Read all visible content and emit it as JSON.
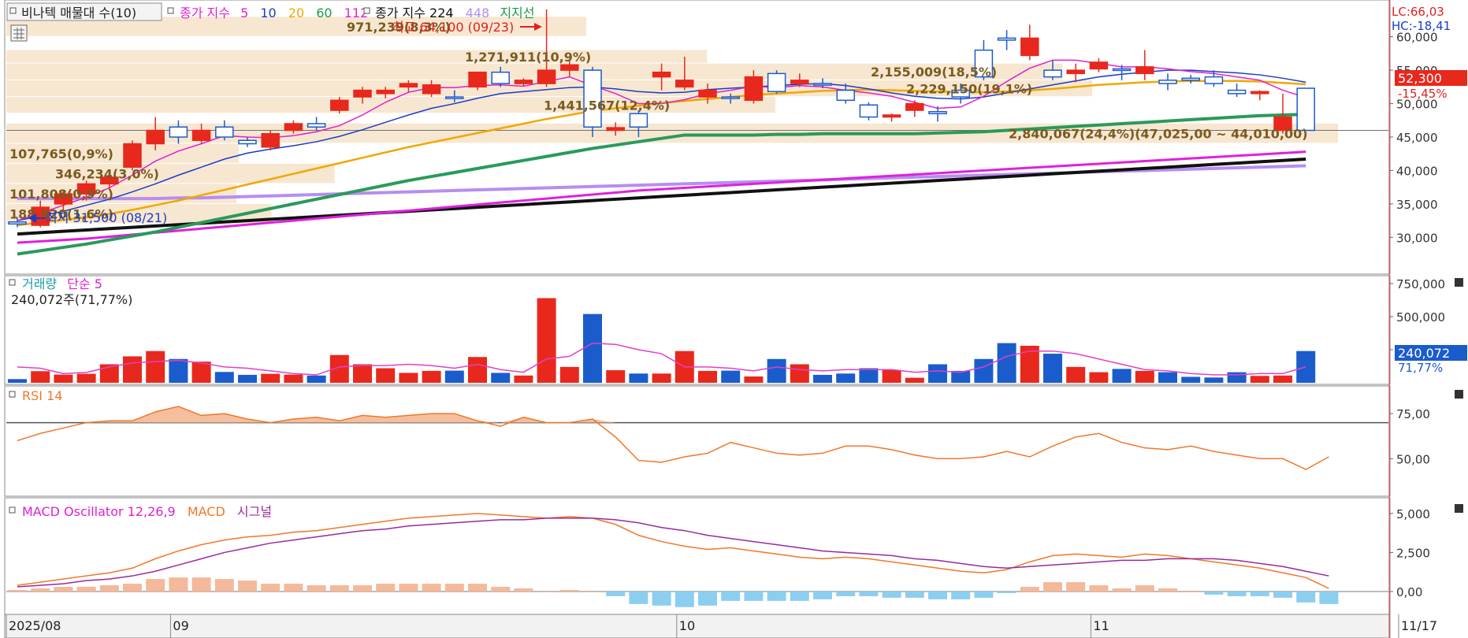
{
  "header": {
    "indicator": "비나텍 매물대 수(10)",
    "ma_title": "종가 지수",
    "ma_periods": [
      {
        "label": "5",
        "color": "#e020d0"
      },
      {
        "label": "10",
        "color": "#1a3cc8"
      },
      {
        "label": "20",
        "color": "#f0a800"
      },
      {
        "label": "60",
        "color": "#1a9a4a"
      },
      {
        "label": "112",
        "color": "#e020e0"
      }
    ],
    "ma2_title": "종가 지수 224",
    "ma2_extra": {
      "label": "448",
      "color": "#b68ef0"
    },
    "support_label": "지지선",
    "corner_lc": "LC:66,03",
    "corner_hc": "HC:-18,41"
  },
  "annotations": {
    "high_label": "최고 64,100 (09/23)",
    "low_label": "최저 31,500 (08/21)"
  },
  "price_badge": {
    "price": "52,300",
    "change": "-15,45%"
  },
  "volume_panel": {
    "title": "거래량",
    "ma_label": "단순 5",
    "last_info": "240,072주(71,77%)",
    "badge_value": "240,072",
    "badge_pct": "71,77%"
  },
  "rsi_panel": {
    "title": "RSI 14"
  },
  "macd_panel": {
    "title": "MACD Oscillator 12,26,9",
    "macd_label": "MACD",
    "signal_label": "시그널"
  },
  "colors": {
    "up": "#e8281c",
    "down": "#1a5ccc",
    "volume_ma": "#e040c8",
    "rsi": "#f07828",
    "rsi_fill": "#f4b894",
    "macd": "#f07828",
    "signal": "#9a2a9a",
    "osc_pos": "#f4b89a",
    "osc_neg": "#8ccef0",
    "profile": "#f6e4cc"
  },
  "chart_data": {
    "type": "candlestick",
    "price_axis": {
      "ticks": [
        "60,000",
        "55,000",
        "50,000",
        "45,000",
        "40,000",
        "35,000",
        "30,000"
      ],
      "values": [
        60000,
        55000,
        50000,
        45000,
        40000,
        35000,
        30000
      ]
    },
    "volume_axis": {
      "ticks": [
        "750,000",
        "500,000",
        "250,000"
      ],
      "values": [
        750000,
        500000,
        250000
      ]
    },
    "rsi_axis": {
      "ticks": [
        "75,00",
        "50,00"
      ],
      "values": [
        75,
        50
      ]
    },
    "macd_axis": {
      "ticks": [
        "5,000",
        "2,500",
        "0,00"
      ],
      "values": [
        5000,
        2500,
        0
      ]
    },
    "date_labels": [
      {
        "label": "2025/08",
        "index": 0
      },
      {
        "label": "09",
        "index": 7
      },
      {
        "label": "10",
        "index": 29
      },
      {
        "label": "11",
        "index": 47
      },
      {
        "label": "11/17",
        "index": 60
      }
    ],
    "candles": [
      {
        "o": 32300,
        "h": 33000,
        "l": 31500,
        "c": 32000
      },
      {
        "o": 31800,
        "h": 35500,
        "l": 31500,
        "c": 34500
      },
      {
        "o": 35000,
        "h": 37000,
        "l": 34000,
        "c": 36500
      },
      {
        "o": 36500,
        "h": 38500,
        "l": 35500,
        "c": 38000
      },
      {
        "o": 38000,
        "h": 40000,
        "l": 37000,
        "c": 39000
      },
      {
        "o": 40500,
        "h": 44500,
        "l": 40000,
        "c": 44000
      },
      {
        "o": 44000,
        "h": 48000,
        "l": 43000,
        "c": 46000
      },
      {
        "o": 46500,
        "h": 47500,
        "l": 44000,
        "c": 45000
      },
      {
        "o": 44500,
        "h": 47000,
        "l": 44000,
        "c": 46000
      },
      {
        "o": 46500,
        "h": 47500,
        "l": 44500,
        "c": 45000
      },
      {
        "o": 44500,
        "h": 45000,
        "l": 43500,
        "c": 44000
      },
      {
        "o": 43500,
        "h": 46000,
        "l": 43000,
        "c": 45500
      },
      {
        "o": 46000,
        "h": 47500,
        "l": 45500,
        "c": 47000
      },
      {
        "o": 47000,
        "h": 48000,
        "l": 46000,
        "c": 46500
      },
      {
        "o": 49000,
        "h": 51000,
        "l": 48500,
        "c": 50500
      },
      {
        "o": 51000,
        "h": 52500,
        "l": 50000,
        "c": 52000
      },
      {
        "o": 51500,
        "h": 52500,
        "l": 50800,
        "c": 52000
      },
      {
        "o": 52500,
        "h": 53500,
        "l": 51800,
        "c": 53000
      },
      {
        "o": 51500,
        "h": 53500,
        "l": 51000,
        "c": 52800
      },
      {
        "o": 51000,
        "h": 52000,
        "l": 50200,
        "c": 50800
      },
      {
        "o": 52500,
        "h": 54700,
        "l": 52000,
        "c": 54700
      },
      {
        "o": 54700,
        "h": 55500,
        "l": 52500,
        "c": 53000
      },
      {
        "o": 53000,
        "h": 53800,
        "l": 52600,
        "c": 53500
      },
      {
        "o": 53000,
        "h": 64100,
        "l": 52500,
        "c": 55000
      },
      {
        "o": 55000,
        "h": 56500,
        "l": 54000,
        "c": 55800
      },
      {
        "o": 55000,
        "h": 55500,
        "l": 45000,
        "c": 46500
      },
      {
        "o": 46000,
        "h": 47200,
        "l": 45200,
        "c": 46400
      },
      {
        "o": 48500,
        "h": 49000,
        "l": 45000,
        "c": 46500
      },
      {
        "o": 54000,
        "h": 56000,
        "l": 52000,
        "c": 54700
      },
      {
        "o": 52500,
        "h": 57000,
        "l": 52000,
        "c": 53500
      },
      {
        "o": 51000,
        "h": 53000,
        "l": 50000,
        "c": 52000
      },
      {
        "o": 51000,
        "h": 51500,
        "l": 50000,
        "c": 50800
      },
      {
        "o": 50500,
        "h": 55000,
        "l": 50000,
        "c": 54000
      },
      {
        "o": 54500,
        "h": 55000,
        "l": 51500,
        "c": 51800
      },
      {
        "o": 53000,
        "h": 54500,
        "l": 52500,
        "c": 53500
      },
      {
        "o": 53000,
        "h": 53800,
        "l": 52300,
        "c": 52800
      },
      {
        "o": 52000,
        "h": 53000,
        "l": 50000,
        "c": 50500
      },
      {
        "o": 49800,
        "h": 50200,
        "l": 47500,
        "c": 48000
      },
      {
        "o": 48000,
        "h": 48500,
        "l": 47300,
        "c": 48300
      },
      {
        "o": 49000,
        "h": 50500,
        "l": 48000,
        "c": 50000
      },
      {
        "o": 48800,
        "h": 49600,
        "l": 47300,
        "c": 48500
      },
      {
        "o": 52000,
        "h": 53000,
        "l": 50000,
        "c": 51000
      },
      {
        "o": 58000,
        "h": 59500,
        "l": 53500,
        "c": 54000
      },
      {
        "o": 59800,
        "h": 61000,
        "l": 58000,
        "c": 59500
      },
      {
        "o": 57200,
        "h": 61800,
        "l": 56500,
        "c": 59800
      },
      {
        "o": 55000,
        "h": 56500,
        "l": 53500,
        "c": 54000
      },
      {
        "o": 54500,
        "h": 56000,
        "l": 53200,
        "c": 55000
      },
      {
        "o": 55200,
        "h": 56800,
        "l": 54700,
        "c": 56200
      },
      {
        "o": 55200,
        "h": 55800,
        "l": 53500,
        "c": 55000
      },
      {
        "o": 54500,
        "h": 58000,
        "l": 53500,
        "c": 55500
      },
      {
        "o": 53500,
        "h": 54500,
        "l": 52000,
        "c": 53000
      },
      {
        "o": 53800,
        "h": 54300,
        "l": 53000,
        "c": 53500
      },
      {
        "o": 54000,
        "h": 55000,
        "l": 52500,
        "c": 53000
      },
      {
        "o": 52000,
        "h": 53000,
        "l": 51000,
        "c": 51500
      },
      {
        "o": 51500,
        "h": 52000,
        "l": 50500,
        "c": 51800
      },
      {
        "o": 46000,
        "h": 51500,
        "l": 45500,
        "c": 48000
      },
      {
        "o": 52300,
        "h": 52300,
        "l": 46000,
        "c": 46000
      }
    ],
    "ma5": [
      32500,
      33600,
      34800,
      36000,
      37400,
      39300,
      41400,
      42900,
      44000,
      45200,
      45000,
      44900,
      45200,
      45800,
      46700,
      48300,
      50200,
      51700,
      52400,
      52400,
      52700,
      52800,
      52600,
      53300,
      54000,
      52700,
      51500,
      50000,
      50000,
      50600,
      51500,
      52000,
      52600,
      52400,
      52700,
      52500,
      52000,
      51600,
      51100,
      50200,
      49300,
      49500,
      51100,
      53300,
      55300,
      56500,
      56500,
      56000,
      55500,
      55500,
      55200,
      54800,
      54500,
      54000,
      53500,
      52000,
      50900
    ],
    "ma10": [
      32500,
      33200,
      33900,
      34800,
      35700,
      36800,
      38000,
      39300,
      40500,
      41700,
      42600,
      43200,
      43700,
      44300,
      45100,
      46100,
      47200,
      48300,
      49300,
      50000,
      50800,
      51500,
      51800,
      52100,
      52400,
      52500,
      52200,
      51800,
      51600,
      51700,
      52100,
      52300,
      52500,
      52700,
      52900,
      53000,
      52700,
      52200,
      51600,
      51100,
      50800,
      50700,
      51000,
      51600,
      52200,
      52800,
      53400,
      54000,
      54400,
      54700,
      55000,
      55000,
      54800,
      54600,
      54300,
      53800,
      53200
    ],
    "ma20": [
      31800,
      32200,
      32600,
      33000,
      33500,
      34100,
      34800,
      35500,
      36300,
      37100,
      37900,
      38700,
      39500,
      40300,
      41100,
      41900,
      42700,
      43500,
      44200,
      44900,
      45600,
      46300,
      47000,
      47700,
      48300,
      48900,
      49300,
      49700,
      50100,
      50400,
      50700,
      51000,
      51300,
      51500,
      51700,
      51900,
      52000,
      52100,
      52000,
      51900,
      51800,
      51700,
      51700,
      51800,
      52000,
      52200,
      52500,
      52800,
      53000,
      53200,
      53300,
      53400,
      53400,
      53400,
      53300,
      53100,
      52900
    ],
    "ma60": [
      27500,
      28000,
      28500,
      29000,
      29600,
      30200,
      30800,
      31500,
      32200,
      32900,
      33600,
      34300,
      35000,
      35700,
      36400,
      37100,
      37800,
      38500,
      39100,
      39700,
      40300,
      40900,
      41500,
      42100,
      42700,
      43300,
      43800,
      44300,
      44800,
      45300,
      45300,
      45300,
      45300,
      45400,
      45400,
      45500,
      45500,
      45500,
      45500,
      45500,
      45600,
      45700,
      45800,
      46000,
      46200,
      46400,
      46600,
      46800,
      47000,
      47200,
      47400,
      47600,
      47800,
      48000,
      48200,
      48300,
      48400
    ],
    "ma112": [
      29200,
      29400,
      29600,
      29800,
      30100,
      30400,
      30700,
      31000,
      31300,
      31600,
      31900,
      32200,
      32500,
      32800,
      33100,
      33400,
      33700,
      34000,
      34300,
      34600,
      34900,
      35200,
      35500,
      35800,
      36100,
      36400,
      36700,
      37000,
      37200,
      37400,
      37600,
      37800,
      38000,
      38200,
      38400,
      38600,
      38800,
      39000,
      39200,
      39400,
      39600,
      39800,
      40000,
      40200,
      40400,
      40600,
      40800,
      41000,
      41200,
      41400,
      41600,
      41800,
      42000,
      42200,
      42400,
      42600,
      42800
    ],
    "ma224": [
      30500,
      30700,
      30900,
      31100,
      31300,
      31500,
      31700,
      31900,
      32100,
      32300,
      32500,
      32700,
      32900,
      33100,
      33300,
      33500,
      33700,
      33900,
      34100,
      34300,
      34500,
      34700,
      34900,
      35100,
      35300,
      35500,
      35700,
      35900,
      36100,
      36300,
      36500,
      36700,
      36900,
      37100,
      37300,
      37500,
      37700,
      37900,
      38100,
      38300,
      38500,
      38700,
      38900,
      39100,
      39300,
      39500,
      39700,
      39900,
      40100,
      40300,
      40500,
      40700,
      40900,
      41100,
      41300,
      41500,
      41700
    ],
    "ma448": [
      35800,
      35800,
      35800,
      35800,
      35800,
      35800,
      35800,
      35900,
      35900,
      36000,
      36100,
      36200,
      36300,
      36400,
      36500,
      36600,
      36700,
      36800,
      36900,
      37000,
      37100,
      37200,
      37300,
      37400,
      37500,
      37600,
      37700,
      37800,
      37900,
      38000,
      38100,
      38200,
      38300,
      38400,
      38500,
      38600,
      38700,
      38800,
      38900,
      39000,
      39100,
      39200,
      39300,
      39400,
      39500,
      39600,
      39700,
      39800,
      39900,
      40000,
      40100,
      40200,
      40300,
      40400,
      40500,
      40600,
      40700
    ],
    "volume_profile": [
      {
        "label": "971,239(8,3%)",
        "price_low": 60000,
        "price_high": 63000,
        "value": 971239
      },
      {
        "label": "1,271,911(10,9%)",
        "price_low": 56000,
        "price_high": 58000,
        "value": 1271911
      },
      {
        "label": "2,155,009(18,5%)",
        "price_low": 53500,
        "price_high": 56000,
        "value": 2155009
      },
      {
        "label": "2,229,150(19,1%)",
        "price_low": 51000,
        "price_high": 53500,
        "value": 2229150
      },
      {
        "label": "1,441,567(12,4%)",
        "price_low": 48500,
        "price_high": 51000,
        "value": 1441567
      },
      {
        "label": "2,840,067(24,4%)(47,025,00 ~ 44,010,00)",
        "price_low": 44010,
        "price_high": 47025,
        "value": 2840067
      },
      {
        "label": "107,765(0,9%)",
        "price_low": 41000,
        "price_high": 44000,
        "value": 107765
      },
      {
        "label": "346,234(3,0%)",
        "price_low": 38000,
        "price_high": 41000,
        "value": 346234
      },
      {
        "label": "101,808(0,9%)",
        "price_low": 35000,
        "price_high": 38000,
        "value": 101808
      },
      {
        "label": "188,920(1,6%)",
        "price_low": 32000,
        "price_high": 35000,
        "value": 188920
      }
    ],
    "volume": [
      28000,
      88000,
      62000,
      68000,
      140000,
      200000,
      240000,
      180000,
      160000,
      82000,
      60000,
      68000,
      62000,
      55000,
      210000,
      140000,
      110000,
      75000,
      90000,
      92000,
      195000,
      75000,
      55000,
      640000,
      120000,
      520000,
      95000,
      70000,
      70000,
      240000,
      90000,
      92000,
      48000,
      180000,
      140000,
      60000,
      70000,
      110000,
      95000,
      38000,
      140000,
      90000,
      180000,
      300000,
      280000,
      220000,
      120000,
      80000,
      105000,
      90000,
      80000,
      45000,
      40000,
      80000,
      52000,
      55000,
      240072
    ],
    "volume_ma5": [
      120000,
      110000,
      70000,
      78000,
      120000,
      150000,
      160000,
      170000,
      150000,
      120000,
      110000,
      90000,
      70000,
      60000,
      120000,
      130000,
      130000,
      140000,
      130000,
      110000,
      140000,
      100000,
      80000,
      180000,
      200000,
      300000,
      290000,
      250000,
      220000,
      120000,
      120000,
      110000,
      90000,
      120000,
      100000,
      90000,
      100000,
      100000,
      100000,
      80000,
      90000,
      80000,
      120000,
      200000,
      240000,
      240000,
      220000,
      180000,
      140000,
      100000,
      90000,
      70000,
      60000,
      60000,
      70000,
      70000,
      120000
    ],
    "rsi": [
      60,
      64,
      67,
      70,
      71,
      71,
      76,
      79,
      74,
      75,
      72,
      70,
      72,
      73,
      71,
      74,
      73,
      74,
      75,
      75,
      71,
      68,
      73,
      70,
      70,
      72,
      62,
      49,
      48,
      51,
      53,
      59,
      56,
      53,
      52,
      53,
      57,
      57,
      55,
      52,
      50,
      50,
      51,
      54,
      51,
      57,
      62,
      64,
      59,
      56,
      55,
      57,
      54,
      52,
      50,
      50,
      44,
      51
    ],
    "macd": [
      400,
      600,
      800,
      1000,
      1200,
      1500,
      2100,
      2600,
      3000,
      3300,
      3500,
      3600,
      3800,
      3900,
      4100,
      4300,
      4500,
      4700,
      4800,
      4900,
      5000,
      4900,
      4800,
      4700,
      4800,
      4700,
      4300,
      3600,
      3200,
      2900,
      2700,
      2800,
      2600,
      2400,
      2200,
      2100,
      2200,
      2100,
      1900,
      1700,
      1500,
      1300,
      1200,
      1400,
      1900,
      2300,
      2400,
      2300,
      2200,
      2400,
      2300,
      2100,
      1900,
      1700,
      1500,
      1200,
      900,
      200
    ],
    "signal": [
      300,
      400,
      500,
      700,
      800,
      1000,
      1300,
      1700,
      2100,
      2500,
      2800,
      3100,
      3300,
      3500,
      3700,
      3900,
      4000,
      4200,
      4300,
      4400,
      4500,
      4600,
      4600,
      4700,
      4700,
      4700,
      4600,
      4400,
      4100,
      3900,
      3600,
      3400,
      3200,
      3000,
      2800,
      2600,
      2500,
      2400,
      2300,
      2100,
      2000,
      1800,
      1600,
      1500,
      1600,
      1700,
      1800,
      1900,
      2000,
      2000,
      2100,
      2100,
      2100,
      2000,
      1800,
      1600,
      1300,
      1000
    ],
    "oscillator": [
      100,
      200,
      300,
      300,
      400,
      500,
      800,
      900,
      900,
      800,
      700,
      500,
      500,
      400,
      400,
      400,
      500,
      500,
      500,
      500,
      500,
      300,
      200,
      0,
      100,
      0,
      -300,
      -800,
      -900,
      -1000,
      -900,
      -600,
      -600,
      -600,
      -600,
      -500,
      -300,
      -300,
      -400,
      -400,
      -500,
      -500,
      -400,
      -100,
      300,
      600,
      600,
      400,
      200,
      400,
      200,
      0,
      -200,
      -300,
      -300,
      -400,
      -700,
      -800
    ]
  }
}
